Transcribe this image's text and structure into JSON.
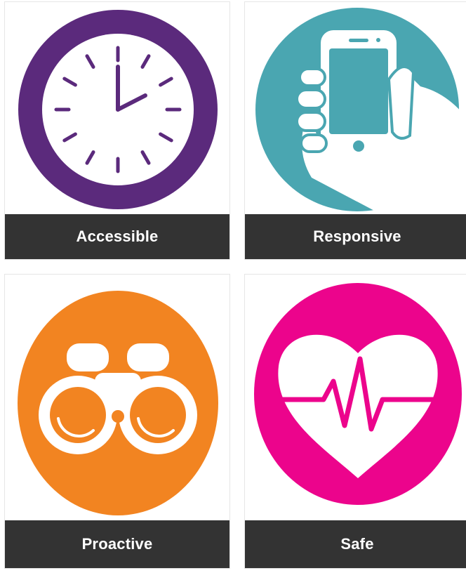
{
  "cards": [
    {
      "label": "Accessible",
      "icon": "clock-icon",
      "color": "#5b2a7c"
    },
    {
      "label": "Responsive",
      "icon": "phone-in-hand-icon",
      "color": "#4aa6b1"
    },
    {
      "label": "Proactive",
      "icon": "binoculars-icon",
      "color": "#f28421"
    },
    {
      "label": "Safe",
      "icon": "heart-pulse-icon",
      "color": "#ec048c"
    }
  ]
}
